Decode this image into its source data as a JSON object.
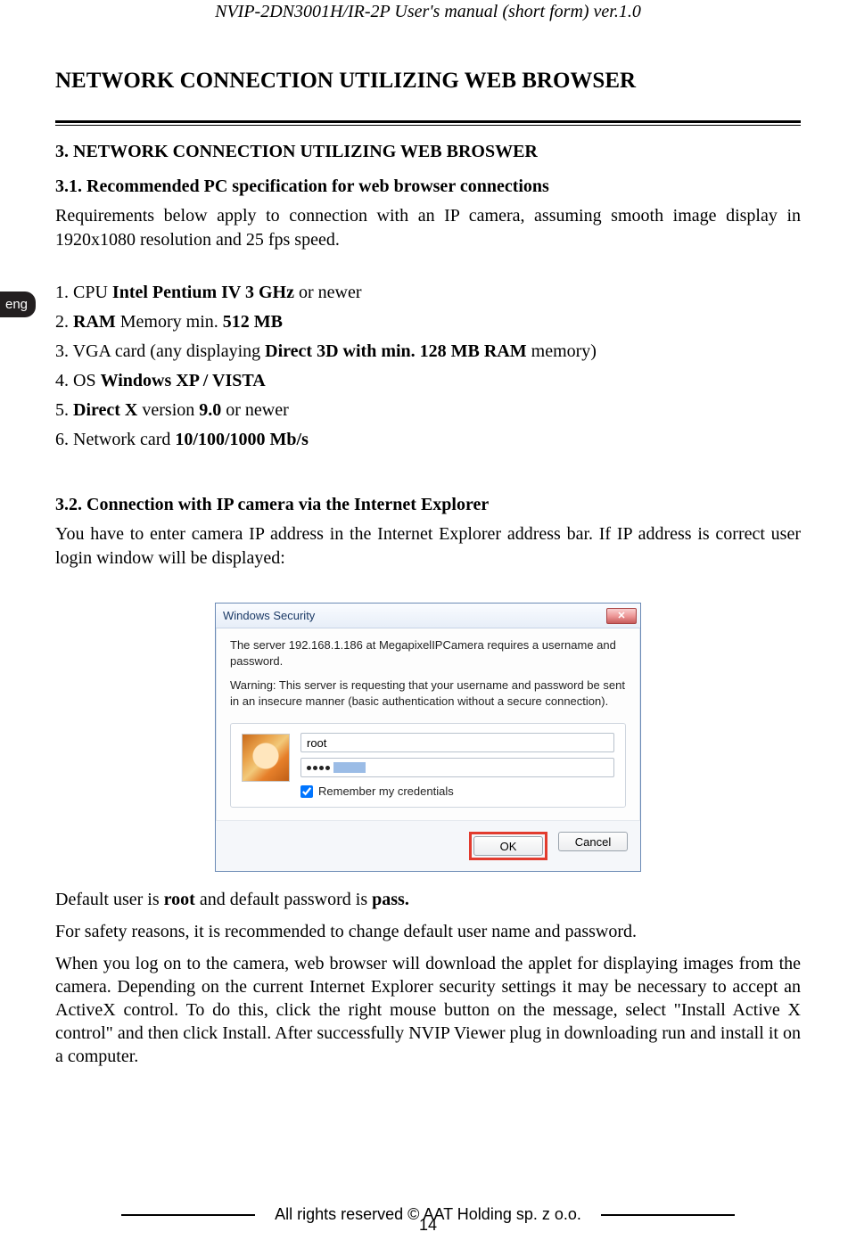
{
  "header": {
    "doc_title": "NVIP-2DN3001H/IR-2P User's manual (short form) ver.1.0"
  },
  "lang_tab": "eng",
  "main_heading": "NETWORK CONNECTION UTILIZING WEB BROWSER",
  "section3": {
    "title": "3. NETWORK CONNECTION UTILIZING WEB BROSWER",
    "s31_title": "3.1. Recommended PC specification for web browser connections",
    "s31_intro": "Requirements below apply to connection with an IP camera, assuming smooth image display in 1920x1080 resolution and 25 fps speed.",
    "specs": [
      {
        "pre": "1. CPU ",
        "bold": "Intel Pentium IV 3 GHz",
        "post": " or newer"
      },
      {
        "pre": "2. ",
        "bold": "RAM",
        "post": " Memory min. ",
        "bold2": "512 MB"
      },
      {
        "pre": "3. VGA card (any displaying ",
        "bold": "Direct 3D with min. 128 MB RAM",
        "post": " memory)"
      },
      {
        "pre": "4. OS ",
        "bold": "Windows XP / VISTA",
        "post": ""
      },
      {
        "pre": "5. ",
        "bold": "Direct X",
        "post": " version ",
        "bold2": "9.0",
        "post2": " or newer"
      },
      {
        "pre": "6. Network card ",
        "bold": "10/100/1000 Mb/s",
        "post": ""
      }
    ],
    "s32_title": "3.2. Connection with IP camera via the Internet Explorer",
    "s32_intro": "You have to enter camera IP address in the Internet Explorer address bar. If IP address is correct user login window will be displayed:"
  },
  "dialog": {
    "title": "Windows Security",
    "line1": "The server 192.168.1.186 at MegapixelIPCamera requires a username and password.",
    "line2": "Warning: This server is requesting that your username and password be sent in an insecure manner (basic authentication without a secure connection).",
    "username_value": "root",
    "remember_label": "Remember my credentials",
    "ok_label": "OK",
    "cancel_label": "Cancel"
  },
  "below": {
    "default_line_pre": "Default user is ",
    "default_user": "root",
    "default_mid": " and default password is ",
    "default_pass": "pass.",
    "safety_line": "For safety reasons, it is recommended to change default user name and password.",
    "long_para": "When you log on to the camera, web browser will download the applet for displaying images from the camera. Depending on the current Internet Explorer security settings it may be necessary to accept an ActiveX control. To do this, click the right mouse button on the message, select \"Install Active X control\" and then click Install. After successfully NVIP Viewer plug in downloading run and install it on a computer."
  },
  "footer": {
    "copyright": "All rights reserved © AAT Holding sp. z o.o.",
    "page_num": "14"
  }
}
